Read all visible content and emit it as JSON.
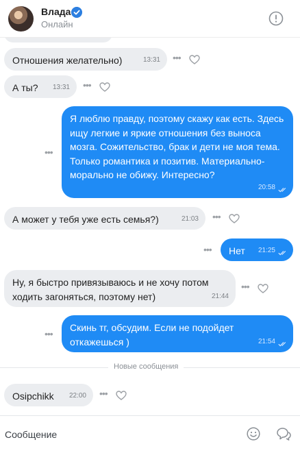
{
  "header": {
    "contact_name": "Влада",
    "contact_status": "Онлайн"
  },
  "messages": [
    {
      "direction": "in",
      "text": "Отношения желательно)",
      "time": "13:31"
    },
    {
      "direction": "in",
      "text": "А ты?",
      "time": "13:31"
    },
    {
      "direction": "out",
      "text": "Я люблю правду, поэтому скажу как есть. Здесь ищу легкие и яркие отношения без выноса мозга. Сожительство, брак и дети не моя тема. Только романтика и позитив. Материально-морально не обижу. Интересно?",
      "time": "20:58"
    },
    {
      "direction": "in",
      "text": "А может у тебя уже есть семья?)",
      "time": "21:03"
    },
    {
      "direction": "out",
      "text": "Нет",
      "time": "21:25"
    },
    {
      "direction": "in",
      "text": "Ну, я быстро привязываюсь и не хочу потом ходить загоняться, поэтому нет)",
      "time": "21:44"
    },
    {
      "direction": "out",
      "text": "Скинь тг, обсудим. Если не подойдет откажешься )",
      "time": "21:54"
    },
    {
      "direction": "in",
      "text": "Osipchikk",
      "time": "22:00"
    }
  ],
  "divider": {
    "label": "Новые сообщения"
  },
  "composer": {
    "placeholder": "Сообщение"
  },
  "colors": {
    "outgoing_bubble": "#1f8bf5",
    "incoming_bubble": "#ebedf0",
    "accent": "#2d7fe0"
  }
}
